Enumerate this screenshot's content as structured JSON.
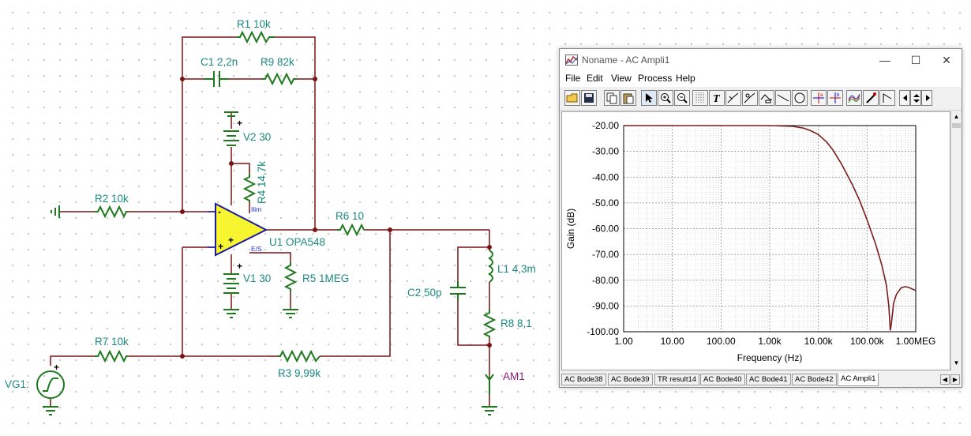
{
  "schematic": {
    "labels": {
      "r1": "R1 10k",
      "c1": "C1 2,2n",
      "r9": "R9 82k",
      "v2": "V2 30",
      "r4": "R4 14,7k",
      "r2": "R2 10k",
      "ilim": "Ilim",
      "r6": "R6 10",
      "u1": "U1 OPA548",
      "es": "E/S",
      "l1": "L1 4,3m",
      "v1": "V1 30",
      "r5": "R5 1MEG",
      "c2": "C2 50p",
      "r8": "R8 8,1",
      "r7": "R7 10k",
      "r3": "R3 9,99k",
      "vg1": "VG1:",
      "am1": "AM1",
      "plus": "+",
      "minus": "-"
    }
  },
  "window": {
    "title": "Noname - AC Ampli1",
    "minimize": "—",
    "maximize": "☐",
    "close": "✕",
    "menu": [
      "File",
      "Edit",
      "View",
      "Process",
      "Help"
    ],
    "toolbar_icons": [
      "open-icon",
      "save-icon",
      "copy-icon",
      "paste-icon",
      "pointer-icon",
      "zoom-in-icon",
      "zoom-out-icon",
      "grid-icon",
      "text-icon",
      "curve-a-icon",
      "curve-b-icon",
      "curve-c-icon",
      "line-icon",
      "circle-icon",
      "cursor-a-icon",
      "cursor-b-icon",
      "graph-icon",
      "pen-icon",
      "marker-icon",
      "left-right-icon",
      "up-down-icon",
      "right-icon"
    ],
    "tabs": [
      "AC Bode38",
      "AC Bode39",
      "TR result14",
      "AC Bode40",
      "AC Bode41",
      "AC Bode42",
      "AC Ampli1"
    ],
    "active_tab": "AC Ampli1"
  },
  "chart_data": {
    "type": "line",
    "xlabel": "Frequency (Hz)",
    "ylabel": "Gain (dB)",
    "xscale": "log",
    "xlim": [
      1,
      1000000
    ],
    "ylim": [
      -100,
      -20
    ],
    "x_tick_labels": [
      "1.00",
      "10.00",
      "100.00",
      "1.00k",
      "10.00k",
      "100.00k",
      "1.00MEG"
    ],
    "y_tick_labels": [
      "-20.00",
      "-30.00",
      "-40.00",
      "-50.00",
      "-60.00",
      "-70.00",
      "-80.00",
      "-90.00",
      "-100.00"
    ],
    "grid": true,
    "series": [
      {
        "color": "#7b1c1c",
        "x": [
          1,
          10,
          100,
          1000,
          3000,
          5000,
          7000,
          10000,
          15000,
          20000,
          30000,
          50000,
          70000,
          100000,
          150000,
          200000,
          250000,
          280000,
          300000,
          320000,
          350000,
          400000,
          500000,
          600000,
          700000,
          800000,
          1000000
        ],
        "y": [
          -20,
          -20,
          -20,
          -20,
          -20.3,
          -21,
          -22,
          -23.5,
          -26.5,
          -29.5,
          -35,
          -43,
          -49,
          -56.5,
          -66,
          -74,
          -82,
          -90,
          -99.5,
          -96,
          -89,
          -85.5,
          -83,
          -82.5,
          -82.7,
          -83.2,
          -84
        ]
      }
    ]
  }
}
